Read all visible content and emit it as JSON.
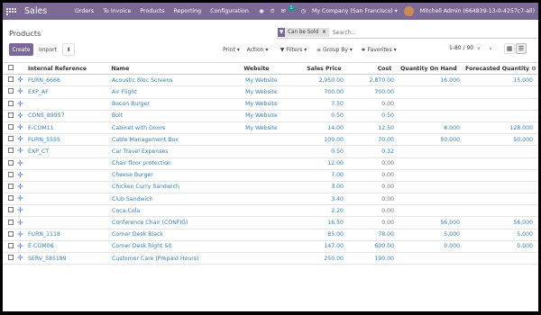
{
  "nav": {
    "app_name": "Sales",
    "menu": [
      "Orders",
      "To Invoice",
      "Products",
      "Reporting",
      "Configuration"
    ],
    "chat_count": "5",
    "company": "My Company (San Francisco)",
    "user": "Mitchell Admin (664839-13-0-4257c7-all)"
  },
  "control": {
    "breadcrumb": "Products",
    "create_label": "Create",
    "import_label": "Import",
    "print_label": "Print",
    "action_label": "Action",
    "filters_label": "Filters",
    "groupby_label": "Group By",
    "favorites_label": "Favorites",
    "facet_label": "Can be Sold",
    "search_placeholder": "Search...",
    "pager": "1-80 / 90"
  },
  "columns": {
    "ref": "Internal Reference",
    "name": "Name",
    "website": "Website",
    "price": "Sales Price",
    "cost": "Cost",
    "on_hand": "Quantity On Hand",
    "forecast": "Forecasted Quantity"
  },
  "rows": [
    {
      "ref": "FURN_6666",
      "name": "Acoustic Bloc Screens",
      "website": "My Website",
      "price": "2,950.00",
      "cost": "2,870.00",
      "on_hand": "16.000",
      "forecast": "15.000"
    },
    {
      "ref": "EXP_AF",
      "name": "Air Flight",
      "website": "My Website",
      "price": "700.00",
      "cost": "700.00",
      "on_hand": "",
      "forecast": ""
    },
    {
      "ref": "",
      "name": "Bacon Burger",
      "website": "My Website",
      "price": "7.50",
      "cost": "0.00",
      "on_hand": "",
      "forecast": ""
    },
    {
      "ref": "CONS_89957",
      "name": "Bolt",
      "website": "My Website",
      "price": "0.50",
      "cost": "0.50",
      "on_hand": "",
      "forecast": ""
    },
    {
      "ref": "E-COM11",
      "name": "Cabinet with Doors",
      "website": "My Website",
      "price": "14.00",
      "cost": "12.50",
      "on_hand": "8.000",
      "forecast": "128.000"
    },
    {
      "ref": "FURN_5555",
      "name": "Cable Management Box",
      "website": "",
      "price": "100.00",
      "cost": "70.00",
      "on_hand": "50.000",
      "forecast": "50.000"
    },
    {
      "ref": "EXP_CT",
      "name": "Car Travel Expenses",
      "website": "",
      "price": "0.50",
      "cost": "0.32",
      "on_hand": "",
      "forecast": ""
    },
    {
      "ref": "",
      "name": "Chair floor protection",
      "website": "",
      "price": "12.00",
      "cost": "0.00",
      "on_hand": "",
      "forecast": ""
    },
    {
      "ref": "",
      "name": "Cheese Burger",
      "website": "",
      "price": "7.00",
      "cost": "0.00",
      "on_hand": "",
      "forecast": ""
    },
    {
      "ref": "",
      "name": "Chicken Curry Sandwich",
      "website": "",
      "price": "3.00",
      "cost": "0.00",
      "on_hand": "",
      "forecast": ""
    },
    {
      "ref": "",
      "name": "Club Sandwich",
      "website": "",
      "price": "3.40",
      "cost": "0.00",
      "on_hand": "",
      "forecast": ""
    },
    {
      "ref": "",
      "name": "Coca-Cola",
      "website": "",
      "price": "2.20",
      "cost": "0.00",
      "on_hand": "",
      "forecast": ""
    },
    {
      "ref": "",
      "name": "Conference Chair (CONFIG)",
      "website": "",
      "price": "16.50",
      "cost": "0.00",
      "on_hand": "56.000",
      "forecast": "56.000"
    },
    {
      "ref": "FURN_1118",
      "name": "Corner Desk Black",
      "website": "",
      "price": "85.00",
      "cost": "78.00",
      "on_hand": "5.000",
      "forecast": "5.000"
    },
    {
      "ref": "E-COM06",
      "name": "Corner Desk Right Sit",
      "website": "",
      "price": "147.00",
      "cost": "600.00",
      "on_hand": "0.000",
      "forecast": "0.000"
    },
    {
      "ref": "SERV_585189",
      "name": "Customer Care (Prepaid Hours)",
      "website": "",
      "price": "250.00",
      "cost": "190.00",
      "on_hand": "",
      "forecast": ""
    }
  ]
}
